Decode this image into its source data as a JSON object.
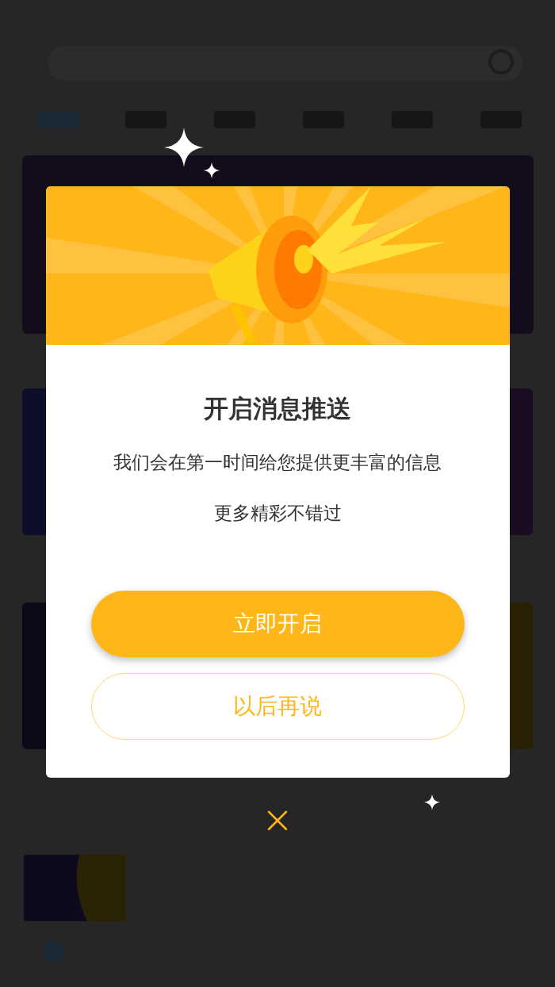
{
  "dialog": {
    "title": "开启消息推送",
    "message": [
      "我们会在第一时间给您提供更丰富的信息",
      "更多精彩不错过"
    ],
    "buttons": [
      {
        "label": "立即开启",
        "kind": "primary"
      },
      {
        "label": "以后再说",
        "kind": "secondary"
      }
    ]
  }
}
